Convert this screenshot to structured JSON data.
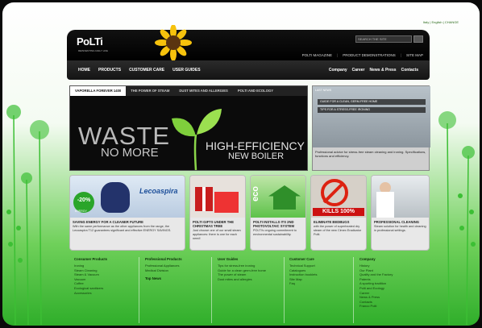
{
  "top_links": "Italy | English | CHANGE",
  "brand": {
    "logo": "PoLTi",
    "tagline": "REINVENTING DAILY LIFE"
  },
  "search": {
    "placeholder": "SEARCH THE SITE"
  },
  "util_nav": [
    "POLTI MAGAZINE",
    "PRODUCT DEMONSTRATIONS",
    "SITE MAP"
  ],
  "main_nav": {
    "left": [
      "HOME",
      "PRODUCTS",
      "CUSTOMER CARE",
      "USER GUIDES"
    ],
    "right": [
      "Company",
      "Career",
      "News & Press",
      "Contacts"
    ]
  },
  "hero": {
    "tabs": [
      "VAPORELLA FOREVER 1400",
      "THE POWER OF STEAM",
      "DUST MITES AND ALLERGIES",
      "POLTI AND ECOLOGY"
    ],
    "headline_1": "WASTE",
    "headline_2": "NO MORE",
    "subline_1": "HIGH-EFFICIENCY",
    "subline_2": "NEW BOILER"
  },
  "side": {
    "tag": "LAST NEWS",
    "items": [
      "GUIDE FOR A CLEAN, GERM-FREE HOME",
      "TIPS FOR A STRESS-FREE IRONING"
    ],
    "caption": "Professional advice for stress-free steam cleaning and ironing. Specifications, functions and efficiency."
  },
  "tiles": [
    {
      "title": "SAVING ENERGY FOR A CLEANER FUTURE",
      "desc": "With the same performance as the other appliances from the range, the Lecoaspira T12 guarantees significant and effective ENERGY SAVINGS.",
      "badge": "-20%",
      "badge_sub": "ENERGY",
      "brand": "Lecoaspira"
    },
    {
      "title": "POLTI GIFTS UNDER THE CHRISTMAS TREE",
      "desc": "Just choose one of our small steam appliances: there is one for each need!"
    },
    {
      "title": "POLTI INSTALLS ITS 2ND PHOTOVOLTAIC SYSTEM",
      "desc": "POLTI's ongoing commitment to environmental sustainability.",
      "badge": "eco"
    },
    {
      "title": "ELIMINATE BEDBUGS",
      "desc": "with the power of superheated dry steam of the new Cimex Eradicator Polti.",
      "badge": "KILLS 100%"
    },
    {
      "title": "PROFESSIONAL CLEANING",
      "desc": "Steam solution for health and cleaning in professional settings."
    }
  ],
  "footer": [
    {
      "heading": "Consumer Products",
      "links": [
        "Ironing",
        "Steam Cleaning",
        "Steam & Vacuum",
        "Vacuum",
        "Coffee",
        "Ecological sanitizers",
        "Accessories"
      ]
    },
    {
      "heading": "Professional Products",
      "links": [
        "Professional Appliances",
        "Medical Division"
      ],
      "extra": "Top News"
    },
    {
      "heading": "User Guides",
      "links": [
        "Tips for stress-free ironing",
        "Guide for a clean germ-free home",
        "The power of steam",
        "Dust mites and allergies"
      ]
    },
    {
      "heading": "Customer Care",
      "links": [
        "Technical Support",
        "Catalogues",
        "Instruction booklets",
        "Site Map",
        "Faq"
      ]
    },
    {
      "heading": "Company",
      "links": [
        "History",
        "Our Plant",
        "Quality and the Factory",
        "Patents",
        "A sporting tradition",
        "Polti and Ecology",
        "Career",
        "News & Press",
        "Contacts",
        "Franco Polti"
      ]
    }
  ],
  "colors": {
    "accent_green": "#2fae2a",
    "nav_black": "#141414",
    "brand_red": "#d11111"
  }
}
